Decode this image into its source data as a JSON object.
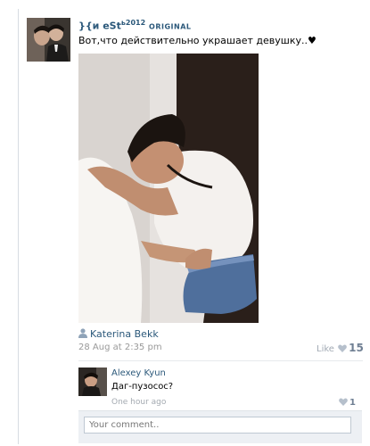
{
  "post": {
    "author_name": "}{и eSt",
    "author_soft_sign": "ь",
    "author_year": "2012",
    "author_tag": "ORIGINAL",
    "text": "Вот,что действительно украшает девушку..♥",
    "photo_credit": "Katerina Bekk",
    "date": "28 Aug at 2:35 pm",
    "like_label": "Like",
    "like_count": "15"
  },
  "comment": {
    "author": "Alexey Kyun",
    "text": "Даг-пузосос?",
    "time": "One hour ago",
    "like_count": "1"
  },
  "comment_form": {
    "placeholder": "Your comment.."
  },
  "colors": {
    "link": "#2b587a",
    "muted": "#999999",
    "like": "#a2aab4"
  }
}
